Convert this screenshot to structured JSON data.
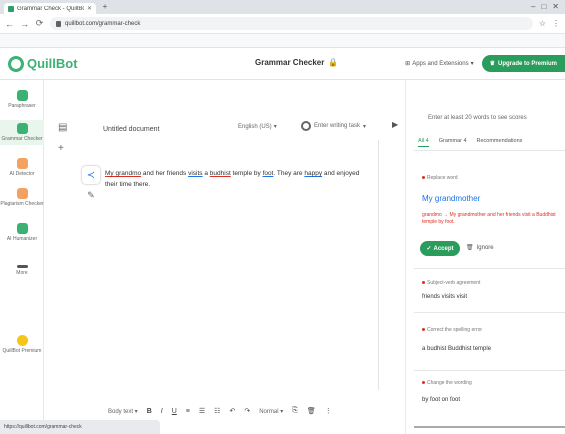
{
  "browser": {
    "tab_title": "Grammar Check - QuillBot",
    "url": "quillbot.com/grammar-check",
    "infobar_message": "",
    "infobar_link": ""
  },
  "app": {
    "logo_text": "QuillBot",
    "title": "Grammar Checker",
    "apps_link": "Apps and Extensions",
    "upgrade_label": "Upgrade to Premium"
  },
  "sidebar": {
    "items": [
      {
        "label": "Paraphraser",
        "icon": "paraphraser-icon",
        "color": "#3bb273"
      },
      {
        "label": "Grammar Checker",
        "icon": "grammar-icon",
        "color": "#3bb273"
      },
      {
        "label": "AI Detector",
        "icon": "ai-detector-icon",
        "color": "#f4a261"
      },
      {
        "label": "Plagiarism Checker",
        "icon": "plagiarism-icon",
        "color": "#f4a261"
      },
      {
        "label": "AI Humanizer",
        "icon": "humanizer-icon",
        "color": "#3bb273"
      },
      {
        "label": "More",
        "icon": "more-icon",
        "color": "#555555"
      },
      {
        "label": "QuillBot Premium",
        "icon": "premium-icon",
        "color": "#f5c518"
      }
    ]
  },
  "editor": {
    "doc_title": "Untitled document",
    "language": "English (US)",
    "mode": "Enter writing task",
    "text_parts": [
      {
        "t": "My grandmo",
        "style": "err"
      },
      {
        "t": " and her friends ",
        "style": ""
      },
      {
        "t": "visits",
        "style": "err-blue"
      },
      {
        "t": " a ",
        "style": ""
      },
      {
        "t": "budhist",
        "style": "err"
      },
      {
        "t": " temple by ",
        "style": ""
      },
      {
        "t": "foot",
        "style": "err-blue"
      },
      {
        "t": ". They are ",
        "style": ""
      },
      {
        "t": "happy",
        "style": "err-blue"
      },
      {
        "t": " and enjoyed their time there.",
        "style": ""
      }
    ],
    "toolbar": {
      "style_select": "Body text",
      "bold": "B",
      "italic": "I",
      "underline": "U",
      "font_size": "Normal"
    },
    "status_text": "https://quillbot.com/grammar-check"
  },
  "panel": {
    "hint": "Enter at least 20 words to see scores",
    "tabs": [
      "All 4",
      "Grammar 4",
      "Recommendations"
    ],
    "card1_label": "Replace word",
    "suggestion": "My grandmother",
    "description": "grandmo → My grandmother and her friends visit a Buddhist temple by foot.",
    "accept": "Accept",
    "ignore": "Ignore",
    "card2_label": "Subject-verb agreement",
    "card2_text": "friends visits visit",
    "card3_label": "Correct the spelling error",
    "card3_text": "a budhist Buddhist temple",
    "card4_label": "Change the wording",
    "card4_text": "by foot on foot"
  }
}
